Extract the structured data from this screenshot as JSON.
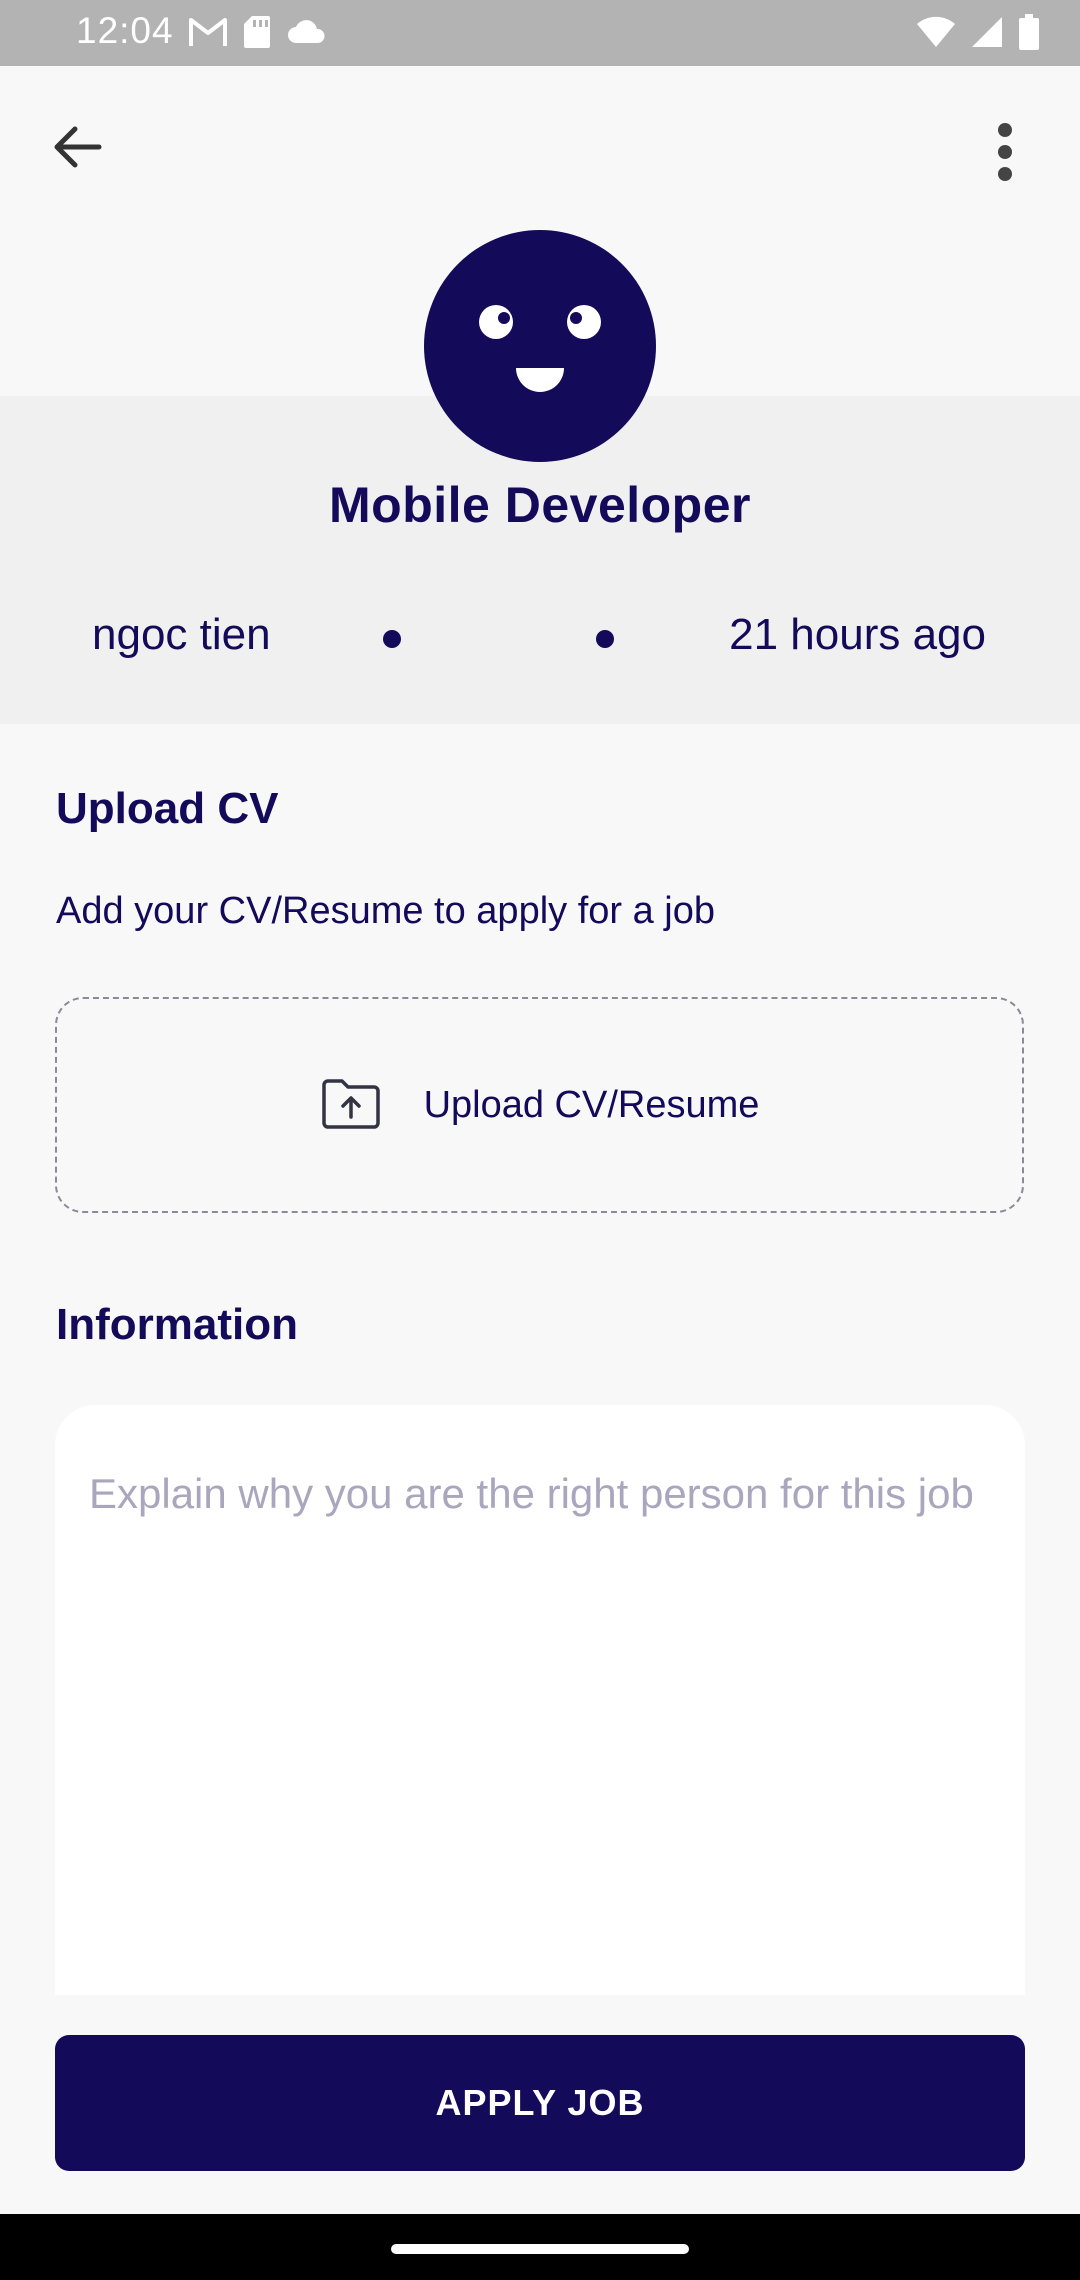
{
  "status_bar": {
    "time": "12:04",
    "left_icons": [
      "gmail-icon",
      "sd-card-icon",
      "cloud-icon"
    ],
    "right_icons": [
      "wifi-icon",
      "signal-icon",
      "battery-icon"
    ]
  },
  "header": {
    "back_icon": "arrow-left-icon",
    "menu_icon": "more-vertical-icon"
  },
  "job": {
    "title": "Mobile Developer",
    "author": "ngoc tien",
    "posted": "21 hours ago"
  },
  "upload": {
    "title": "Upload CV",
    "description": "Add your CV/Resume to apply for a job",
    "button_label": "Upload CV/Resume"
  },
  "information": {
    "title": "Information",
    "placeholder": "Explain why you are the right person for this job",
    "value": ""
  },
  "apply": {
    "label": "APPLY JOB"
  },
  "colors": {
    "primary": "#130a5a",
    "background": "#f8f8f8",
    "banner": "#f0f0f0",
    "placeholder": "#a9a6bd"
  }
}
